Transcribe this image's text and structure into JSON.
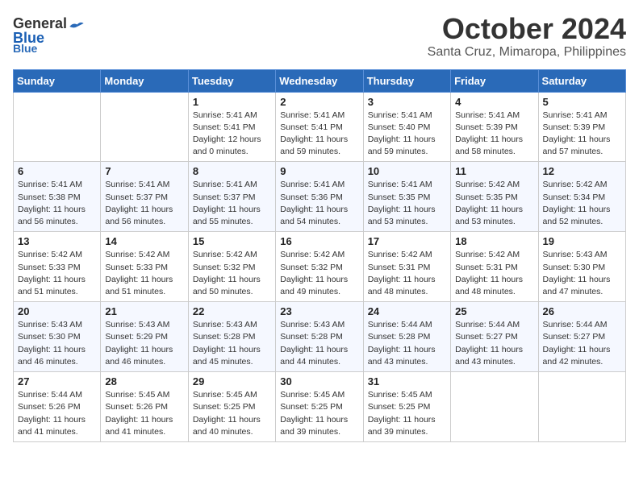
{
  "header": {
    "logo_general": "General",
    "logo_blue": "Blue",
    "month_title": "October 2024",
    "location": "Santa Cruz, Mimaropa, Philippines"
  },
  "weekdays": [
    "Sunday",
    "Monday",
    "Tuesday",
    "Wednesday",
    "Thursday",
    "Friday",
    "Saturday"
  ],
  "weeks": [
    [
      {
        "day": "",
        "sunrise": "",
        "sunset": "",
        "daylight": ""
      },
      {
        "day": "",
        "sunrise": "",
        "sunset": "",
        "daylight": ""
      },
      {
        "day": "1",
        "sunrise": "Sunrise: 5:41 AM",
        "sunset": "Sunset: 5:41 PM",
        "daylight": "Daylight: 12 hours and 0 minutes."
      },
      {
        "day": "2",
        "sunrise": "Sunrise: 5:41 AM",
        "sunset": "Sunset: 5:41 PM",
        "daylight": "Daylight: 11 hours and 59 minutes."
      },
      {
        "day": "3",
        "sunrise": "Sunrise: 5:41 AM",
        "sunset": "Sunset: 5:40 PM",
        "daylight": "Daylight: 11 hours and 59 minutes."
      },
      {
        "day": "4",
        "sunrise": "Sunrise: 5:41 AM",
        "sunset": "Sunset: 5:39 PM",
        "daylight": "Daylight: 11 hours and 58 minutes."
      },
      {
        "day": "5",
        "sunrise": "Sunrise: 5:41 AM",
        "sunset": "Sunset: 5:39 PM",
        "daylight": "Daylight: 11 hours and 57 minutes."
      }
    ],
    [
      {
        "day": "6",
        "sunrise": "Sunrise: 5:41 AM",
        "sunset": "Sunset: 5:38 PM",
        "daylight": "Daylight: 11 hours and 56 minutes."
      },
      {
        "day": "7",
        "sunrise": "Sunrise: 5:41 AM",
        "sunset": "Sunset: 5:37 PM",
        "daylight": "Daylight: 11 hours and 56 minutes."
      },
      {
        "day": "8",
        "sunrise": "Sunrise: 5:41 AM",
        "sunset": "Sunset: 5:37 PM",
        "daylight": "Daylight: 11 hours and 55 minutes."
      },
      {
        "day": "9",
        "sunrise": "Sunrise: 5:41 AM",
        "sunset": "Sunset: 5:36 PM",
        "daylight": "Daylight: 11 hours and 54 minutes."
      },
      {
        "day": "10",
        "sunrise": "Sunrise: 5:41 AM",
        "sunset": "Sunset: 5:35 PM",
        "daylight": "Daylight: 11 hours and 53 minutes."
      },
      {
        "day": "11",
        "sunrise": "Sunrise: 5:42 AM",
        "sunset": "Sunset: 5:35 PM",
        "daylight": "Daylight: 11 hours and 53 minutes."
      },
      {
        "day": "12",
        "sunrise": "Sunrise: 5:42 AM",
        "sunset": "Sunset: 5:34 PM",
        "daylight": "Daylight: 11 hours and 52 minutes."
      }
    ],
    [
      {
        "day": "13",
        "sunrise": "Sunrise: 5:42 AM",
        "sunset": "Sunset: 5:33 PM",
        "daylight": "Daylight: 11 hours and 51 minutes."
      },
      {
        "day": "14",
        "sunrise": "Sunrise: 5:42 AM",
        "sunset": "Sunset: 5:33 PM",
        "daylight": "Daylight: 11 hours and 51 minutes."
      },
      {
        "day": "15",
        "sunrise": "Sunrise: 5:42 AM",
        "sunset": "Sunset: 5:32 PM",
        "daylight": "Daylight: 11 hours and 50 minutes."
      },
      {
        "day": "16",
        "sunrise": "Sunrise: 5:42 AM",
        "sunset": "Sunset: 5:32 PM",
        "daylight": "Daylight: 11 hours and 49 minutes."
      },
      {
        "day": "17",
        "sunrise": "Sunrise: 5:42 AM",
        "sunset": "Sunset: 5:31 PM",
        "daylight": "Daylight: 11 hours and 48 minutes."
      },
      {
        "day": "18",
        "sunrise": "Sunrise: 5:42 AM",
        "sunset": "Sunset: 5:31 PM",
        "daylight": "Daylight: 11 hours and 48 minutes."
      },
      {
        "day": "19",
        "sunrise": "Sunrise: 5:43 AM",
        "sunset": "Sunset: 5:30 PM",
        "daylight": "Daylight: 11 hours and 47 minutes."
      }
    ],
    [
      {
        "day": "20",
        "sunrise": "Sunrise: 5:43 AM",
        "sunset": "Sunset: 5:30 PM",
        "daylight": "Daylight: 11 hours and 46 minutes."
      },
      {
        "day": "21",
        "sunrise": "Sunrise: 5:43 AM",
        "sunset": "Sunset: 5:29 PM",
        "daylight": "Daylight: 11 hours and 46 minutes."
      },
      {
        "day": "22",
        "sunrise": "Sunrise: 5:43 AM",
        "sunset": "Sunset: 5:28 PM",
        "daylight": "Daylight: 11 hours and 45 minutes."
      },
      {
        "day": "23",
        "sunrise": "Sunrise: 5:43 AM",
        "sunset": "Sunset: 5:28 PM",
        "daylight": "Daylight: 11 hours and 44 minutes."
      },
      {
        "day": "24",
        "sunrise": "Sunrise: 5:44 AM",
        "sunset": "Sunset: 5:28 PM",
        "daylight": "Daylight: 11 hours and 43 minutes."
      },
      {
        "day": "25",
        "sunrise": "Sunrise: 5:44 AM",
        "sunset": "Sunset: 5:27 PM",
        "daylight": "Daylight: 11 hours and 43 minutes."
      },
      {
        "day": "26",
        "sunrise": "Sunrise: 5:44 AM",
        "sunset": "Sunset: 5:27 PM",
        "daylight": "Daylight: 11 hours and 42 minutes."
      }
    ],
    [
      {
        "day": "27",
        "sunrise": "Sunrise: 5:44 AM",
        "sunset": "Sunset: 5:26 PM",
        "daylight": "Daylight: 11 hours and 41 minutes."
      },
      {
        "day": "28",
        "sunrise": "Sunrise: 5:45 AM",
        "sunset": "Sunset: 5:26 PM",
        "daylight": "Daylight: 11 hours and 41 minutes."
      },
      {
        "day": "29",
        "sunrise": "Sunrise: 5:45 AM",
        "sunset": "Sunset: 5:25 PM",
        "daylight": "Daylight: 11 hours and 40 minutes."
      },
      {
        "day": "30",
        "sunrise": "Sunrise: 5:45 AM",
        "sunset": "Sunset: 5:25 PM",
        "daylight": "Daylight: 11 hours and 39 minutes."
      },
      {
        "day": "31",
        "sunrise": "Sunrise: 5:45 AM",
        "sunset": "Sunset: 5:25 PM",
        "daylight": "Daylight: 11 hours and 39 minutes."
      },
      {
        "day": "",
        "sunrise": "",
        "sunset": "",
        "daylight": ""
      },
      {
        "day": "",
        "sunrise": "",
        "sunset": "",
        "daylight": ""
      }
    ]
  ]
}
